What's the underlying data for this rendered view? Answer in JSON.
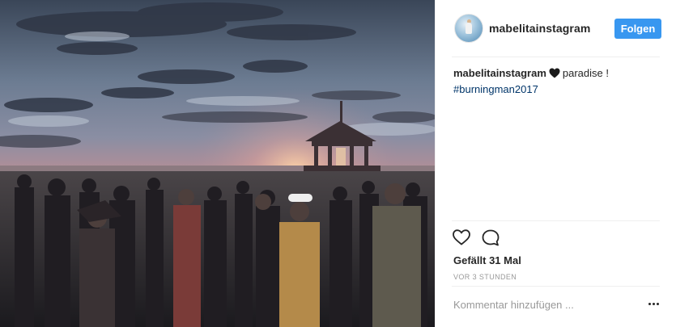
{
  "post": {
    "username": "mabelitainstagram",
    "follow_label": "Folgen",
    "caption": {
      "username": "mabelitainstagram",
      "text": "paradise !",
      "hashtag": "#burningman2017",
      "heart_color": "#1a1a1a"
    },
    "likes_text": "Gefällt 31 Mal",
    "time_text": "VOR 3 STUNDEN",
    "comment_placeholder": "Kommentar hinzufügen ...",
    "icons": {
      "like": "heart-outline-icon",
      "comment": "speech-bubble-icon",
      "more": "ellipsis-icon"
    },
    "colors": {
      "follow_button": "#3897f0",
      "hashtag": "#003569",
      "secondary_text": "#999999"
    }
  }
}
